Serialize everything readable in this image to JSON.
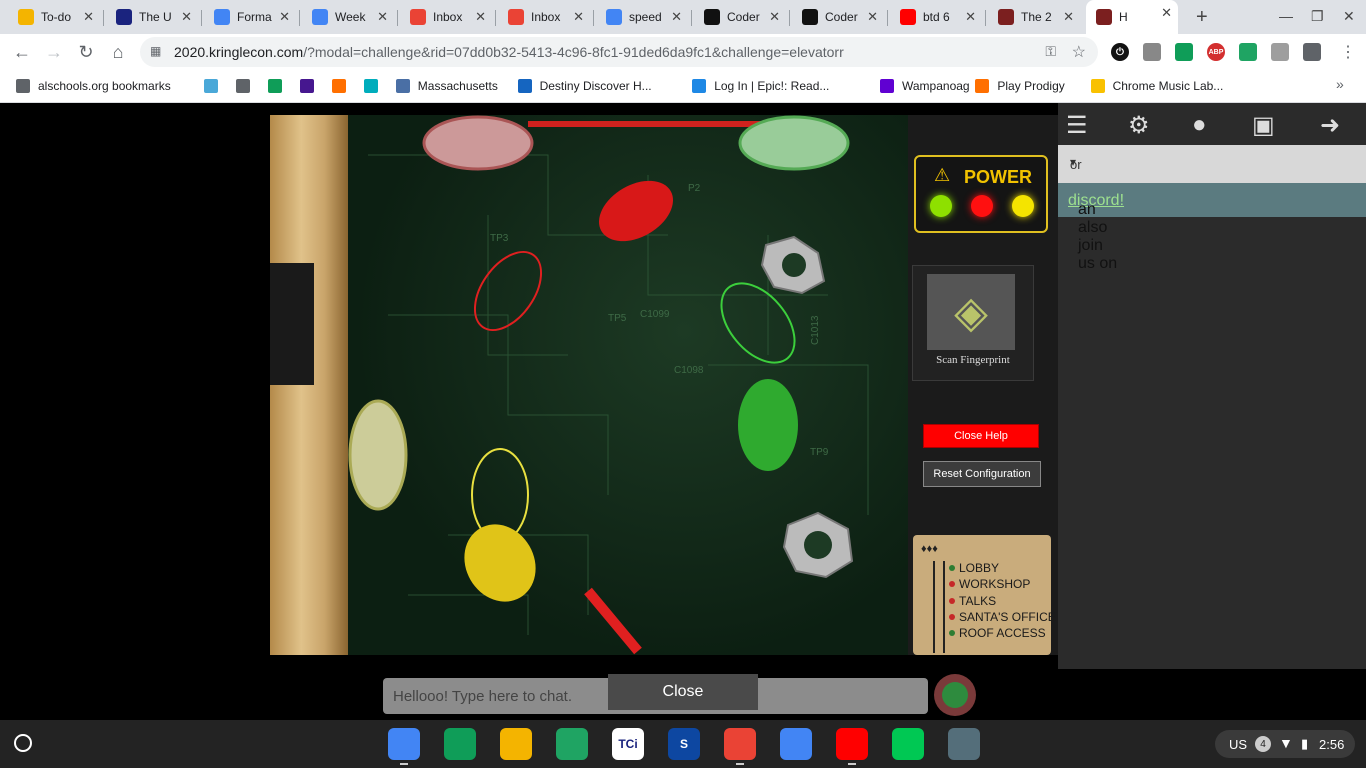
{
  "tabs": [
    {
      "title": "To-do",
      "icon": "todo-icon",
      "color": "#f4b400"
    },
    {
      "title": "The U",
      "icon": "s-icon",
      "color": "#1a237e"
    },
    {
      "title": "Forma",
      "icon": "forms-icon",
      "color": "#4285f4"
    },
    {
      "title": "Week",
      "icon": "docs-icon",
      "color": "#4285f4"
    },
    {
      "title": "Inbox",
      "icon": "gmail-icon",
      "color": "#ea4335"
    },
    {
      "title": "Inbox",
      "icon": "gmail-icon",
      "color": "#ea4335"
    },
    {
      "title": "speed",
      "icon": "google-icon",
      "color": "#4285f4"
    },
    {
      "title": "Coder",
      "icon": "z-icon",
      "color": "#111111"
    },
    {
      "title": "Coder",
      "icon": "z-icon",
      "color": "#111111"
    },
    {
      "title": "btd 6",
      "icon": "youtube-icon",
      "color": "#ff0000"
    },
    {
      "title": "The 2",
      "icon": "kringlecon-icon",
      "color": "#7b1f1f"
    },
    {
      "title": "H",
      "icon": "kringlecon-icon",
      "color": "#7b1f1f"
    }
  ],
  "address_bar": {
    "domain": "2020.kringlecon.com",
    "path": "/?modal=challenge&rid=07dd0b32-5413-4c96-8fc1-91ded6da9fc1&challenge=elevatorr"
  },
  "bookmarks": [
    {
      "label": "alschools.org bookmarks",
      "icon": "folder-icon",
      "color": "#5f6368"
    },
    {
      "label": "",
      "icon": "t-icon",
      "color": "#4aa8d8"
    },
    {
      "label": "",
      "icon": "globe-icon",
      "color": "#5f6368"
    },
    {
      "label": "",
      "icon": "classroom-icon",
      "color": "#0f9d58"
    },
    {
      "label": "",
      "icon": "kahoot-icon",
      "color": "#46178f"
    },
    {
      "label": "",
      "icon": "prodigy-icon",
      "color": "#ff6f00"
    },
    {
      "label": "",
      "icon": "hourofcode-icon",
      "color": "#00adbc"
    },
    {
      "label": "Massachusetts",
      "icon": "map-icon",
      "color": "#4a6fa5"
    },
    {
      "label": "Destiny Discover H...",
      "icon": "destiny-icon",
      "color": "#1565c0"
    },
    {
      "label": "Log In | Epic!: Read...",
      "icon": "epic-icon",
      "color": "#1e88e5"
    },
    {
      "label": "Wampanoag",
      "icon": "yahoo-icon",
      "color": "#6001d2"
    },
    {
      "label": "Play Prodigy",
      "icon": "prodigy-icon",
      "color": "#ff6f00"
    },
    {
      "label": "Chrome Music Lab...",
      "icon": "musiclab-icon",
      "color": "#f9c100"
    }
  ],
  "background_page": {
    "select_text": "or",
    "discord_prefix": "an also join us on",
    "discord_link": "discord!"
  },
  "game": {
    "power_label": "POWER",
    "power_leds": [
      "#8ee000",
      "#ff1010",
      "#f4e400"
    ],
    "scan_label": "Scan Fingerprint",
    "close_help": "Close Help",
    "reset": "Reset Configuration",
    "floors": [
      "LOBBY",
      "WORKSHOP",
      "TALKS",
      "SANTA'S OFFICE",
      "ROOF ACCESS"
    ],
    "board_labels": [
      "TP3",
      "TP5",
      "C1099",
      "C1098",
      "TP9",
      "P2",
      "C1013"
    ]
  },
  "chat": {
    "placeholder": "Hellooo! Type here to chat."
  },
  "close_button": "Close",
  "shelf_apps": [
    {
      "icon": "chrome-icon",
      "color": "#4285f4",
      "label": ""
    },
    {
      "icon": "classroom-icon",
      "color": "#0f9d58",
      "label": ""
    },
    {
      "icon": "slides-icon",
      "color": "#f4b400",
      "label": ""
    },
    {
      "icon": "drive-icon",
      "color": "#1fa463",
      "label": ""
    },
    {
      "icon": "tci-icon",
      "color": "#ffffff",
      "label": "TCi"
    },
    {
      "icon": "s-icon",
      "color": "#0d47a1",
      "label": "S"
    },
    {
      "icon": "gmail-icon",
      "color": "#ea4335",
      "label": ""
    },
    {
      "icon": "docs-icon",
      "color": "#4285f4",
      "label": ""
    },
    {
      "icon": "youtube-icon",
      "color": "#ff0000",
      "label": ""
    },
    {
      "icon": "playstore-icon",
      "color": "#00c853",
      "label": ""
    },
    {
      "icon": "camera-icon",
      "color": "#546e7a",
      "label": ""
    }
  ],
  "tray": {
    "lang": "US",
    "notifications": "4",
    "time": "2:56"
  }
}
